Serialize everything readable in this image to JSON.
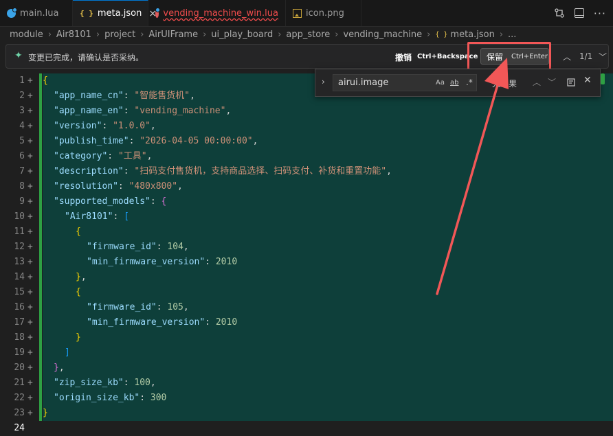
{
  "tabs": [
    {
      "label": "main.lua",
      "icon": "lua-file-icon",
      "active": false
    },
    {
      "label": "meta.json",
      "icon": "json-file-icon",
      "active": true,
      "close": "×"
    },
    {
      "label": "vending_machine_win.lua",
      "icon": "lua-file-icon",
      "active": false,
      "has_error": true
    },
    {
      "label": "icon.png",
      "icon": "image-file-icon",
      "active": false
    }
  ],
  "json_icon_glyph": "{ }",
  "breadcrumb": {
    "items": [
      "module",
      "Air8101",
      "project",
      "AirUIFrame",
      "ui_play_board",
      "app_store",
      "vending_machine",
      "meta.json",
      "..."
    ],
    "separator": "›"
  },
  "ai_bar": {
    "message": "变更已完成，请确认是否采纳。",
    "undo_label": "撤销",
    "undo_shortcut": "Ctrl+Backspace",
    "keep_label": "保留",
    "keep_shortcut": "Ctrl+Enter",
    "change_counter": "1/1",
    "accent_color": "#6fd3a8"
  },
  "find_widget": {
    "search_value": "airui.image",
    "match_case_label": "Aa",
    "whole_word_label": "ab",
    "regex_label": ".*",
    "result_text": "无结果"
  },
  "editor": {
    "line_numbers": [
      "1",
      "2",
      "3",
      "4",
      "5",
      "6",
      "7",
      "8",
      "9",
      "10",
      "11",
      "12",
      "13",
      "14",
      "15",
      "16",
      "17",
      "18",
      "19",
      "20",
      "21",
      "22",
      "23",
      "24"
    ],
    "current_line": "24",
    "diff_marker": "+",
    "strings": {
      "app_name_cn_key": "\"app_name_cn\"",
      "app_name_cn_val": "\"智能售货机\"",
      "app_name_en_key": "\"app_name_en\"",
      "app_name_en_val": "\"vending_machine\"",
      "version_key": "\"version\"",
      "version_val": "\"1.0.0\"",
      "publish_time_key": "\"publish_time\"",
      "publish_time_val": "\"2026-04-05 00:00:00\"",
      "category_key": "\"category\"",
      "category_val": "\"工具\"",
      "description_key": "\"description\"",
      "description_val": "\"扫码支付售货机，支持商品选择、扫码支付、补货和重置功能\"",
      "resolution_key": "\"resolution\"",
      "resolution_val": "\"480x800\"",
      "supported_models_key": "\"supported_models\"",
      "air8101_key": "\"Air8101\"",
      "firmware_id_key": "\"firmware_id\"",
      "firmware_id_val_1": "104",
      "firmware_id_val_2": "105",
      "min_fw_key": "\"min_firmware_version\"",
      "min_fw_val": "2010",
      "zip_size_key": "\"zip_size_kb\"",
      "zip_size_val": "100",
      "origin_size_key": "\"origin_size_kb\"",
      "origin_size_val": "300"
    }
  },
  "colors": {
    "added_line_bg": "#0e3f3a",
    "diff_bar": "#2ea043",
    "annotation_red": "#f25757"
  }
}
